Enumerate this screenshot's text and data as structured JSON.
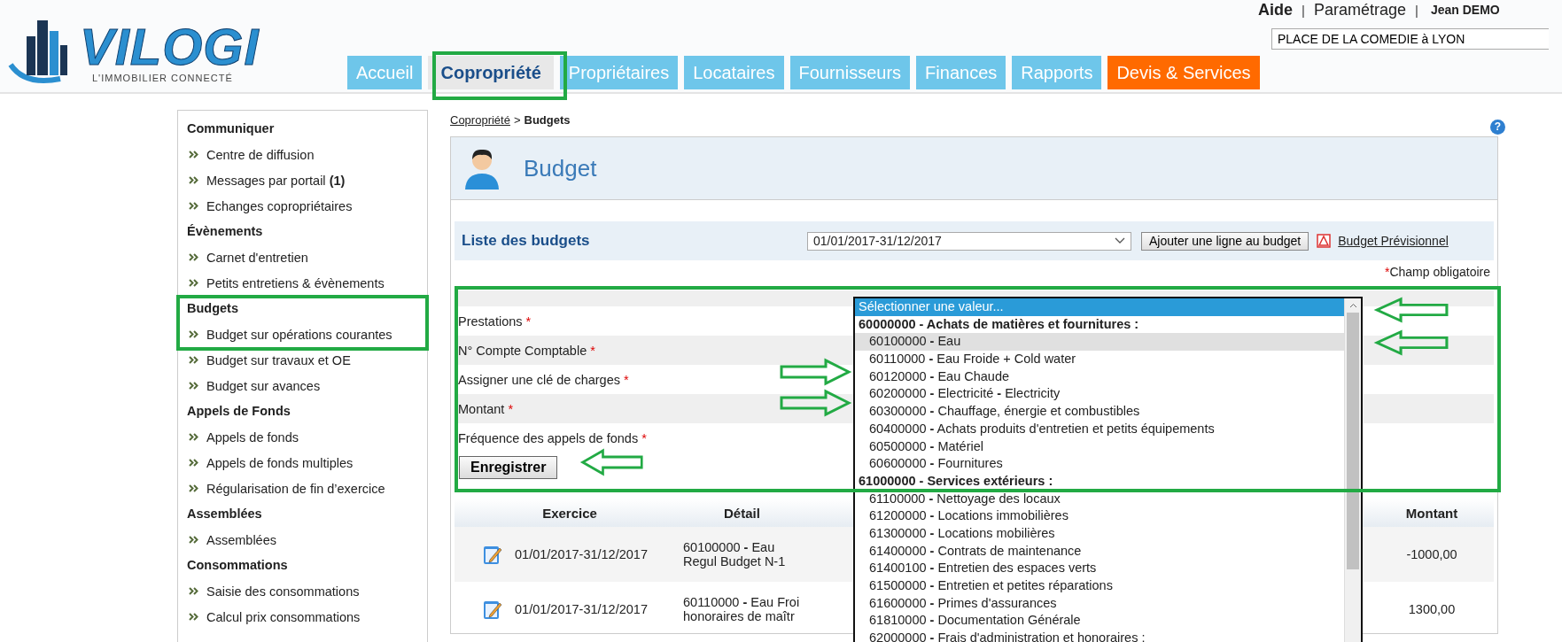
{
  "header": {
    "logo": {
      "name": "VILOGI",
      "tagline": "L'IMMOBILIER CONNECTÉ"
    },
    "links": [
      "Aide",
      "Paramétrage"
    ],
    "separator": "|",
    "user": "Jean DEMO",
    "property_field": {
      "value": "PLACE DE LA COMEDIE à LYON"
    }
  },
  "tabs": [
    {
      "label": "Accueil",
      "selected": false,
      "kind": "normal"
    },
    {
      "label": "Copropriété",
      "selected": true,
      "kind": "normal"
    },
    {
      "label": "Propriétaires",
      "selected": false,
      "kind": "normal"
    },
    {
      "label": "Locataires",
      "selected": false,
      "kind": "normal"
    },
    {
      "label": "Fournisseurs",
      "selected": false,
      "kind": "normal"
    },
    {
      "label": "Finances",
      "selected": false,
      "kind": "normal"
    },
    {
      "label": "Rapports",
      "selected": false,
      "kind": "normal"
    },
    {
      "label": "Devis & Services",
      "selected": false,
      "kind": "promo"
    }
  ],
  "sidebar": {
    "sections": [
      {
        "title": "Communiquer",
        "items": [
          "Centre de diffusion",
          "Messages par portail **(1)**",
          "Echanges copropriétaires"
        ]
      },
      {
        "title": "Évènements",
        "items": [
          "Carnet d'entretien",
          "Petits entretiens & évènements"
        ]
      },
      {
        "title": "Budgets",
        "items": [
          "Budget sur opérations courantes",
          "Budget sur travaux et OE",
          "Budget sur avances"
        ]
      },
      {
        "title": "Appels de Fonds",
        "items": [
          "Appels de fonds",
          "Appels de fonds multiples",
          "Régularisation de fin d’exercice"
        ]
      },
      {
        "title": "Assemblées",
        "items": [
          "Assemblées"
        ]
      },
      {
        "title": "Consommations",
        "items": [
          "Saisie des consommations",
          "Calcul prix consommations"
        ]
      }
    ]
  },
  "breadcrumb": {
    "parent": "Copropriété",
    "separator": ">",
    "current": "Budgets"
  },
  "help": "?",
  "page_title": "Budget",
  "budgets_bar": {
    "title": "Liste des budgets",
    "period_select": {
      "value": "01/01/2017-31/12/2017"
    },
    "add_button": "Ajouter une ligne au budget",
    "pdf_link": "Budget Prévisionnel"
  },
  "required_note": {
    "mark": "*",
    "text": "Champ obligatoire"
  },
  "form": {
    "fields": [
      {
        "label": "Prestations",
        "required_mark": "*"
      },
      {
        "label": "N° Compte Comptable",
        "required_mark": "*"
      },
      {
        "label": "Assigner une clé de charges",
        "required_mark": "*"
      },
      {
        "label": "Montant",
        "required_mark": "*"
      },
      {
        "label": "Fréquence des appels de fonds",
        "required_mark": "*"
      }
    ],
    "save_button": "Enregistrer"
  },
  "dropdown": {
    "options": [
      {
        "kind": "placeholder",
        "text": "Sélectionner une valeur...",
        "selected": true,
        "hovered": false
      },
      {
        "kind": "group",
        "text": "60000000 - Achats de matières et fournitures :",
        "selected": false,
        "hovered": false
      },
      {
        "kind": "option",
        "text": "60100000 **-** Eau",
        "selected": false,
        "hovered": true
      },
      {
        "kind": "option",
        "text": "60110000 **-** Eau Froide + Cold water",
        "selected": false,
        "hovered": false
      },
      {
        "kind": "option",
        "text": "60120000 **-** Eau Chaude",
        "selected": false,
        "hovered": false
      },
      {
        "kind": "option",
        "text": "60200000 **-** Electricité **-** Electricity",
        "selected": false,
        "hovered": false
      },
      {
        "kind": "option",
        "text": "60300000 **-** Chauffage, énergie et combustibles",
        "selected": false,
        "hovered": false
      },
      {
        "kind": "option",
        "text": "60400000 **-** Achats produits d'entretien et petits équipements",
        "selected": false,
        "hovered": false
      },
      {
        "kind": "option",
        "text": "60500000 **-** Matériel",
        "selected": false,
        "hovered": false
      },
      {
        "kind": "option",
        "text": "60600000 **-** Fournitures",
        "selected": false,
        "hovered": false
      },
      {
        "kind": "group",
        "text": "61000000 - Services extérieurs :",
        "selected": false,
        "hovered": false
      },
      {
        "kind": "option",
        "text": "61100000 **-** Nettoyage des locaux",
        "selected": false,
        "hovered": false
      },
      {
        "kind": "option",
        "text": "61200000 **-** Locations immobilières",
        "selected": false,
        "hovered": false
      },
      {
        "kind": "option",
        "text": "61300000 **-** Locations mobilières",
        "selected": false,
        "hovered": false
      },
      {
        "kind": "option",
        "text": "61400000 **-** Contrats de maintenance",
        "selected": false,
        "hovered": false
      },
      {
        "kind": "option",
        "text": "61400100 **-** Entretien des espaces verts",
        "selected": false,
        "hovered": false
      },
      {
        "kind": "option",
        "text": "61500000 **-** Entretien et petites réparations",
        "selected": false,
        "hovered": false
      },
      {
        "kind": "option",
        "text": "61600000 **-** Primes d'assurances",
        "selected": false,
        "hovered": false
      },
      {
        "kind": "option",
        "text": "61810000 **-** Documentation Générale",
        "selected": false,
        "hovered": false
      },
      {
        "kind": "option",
        "text": "62000000 **-** Frais d'administration et honoraires :",
        "selected": false,
        "hovered": false
      }
    ]
  },
  "table": {
    "columns": [
      "Exercice",
      "Détail",
      "Montant"
    ],
    "rows": [
      {
        "exercice": "01/01/2017-31/12/2017",
        "detail": [
          "60100000 **-** Eau",
          "Regul Budget N-1"
        ],
        "montant": "-1000,00"
      },
      {
        "exercice": "01/01/2017-31/12/2017",
        "detail": [
          "60110000 **-** Eau Froi",
          "honoraires de maîtr"
        ],
        "montant": "1300,00"
      }
    ]
  }
}
